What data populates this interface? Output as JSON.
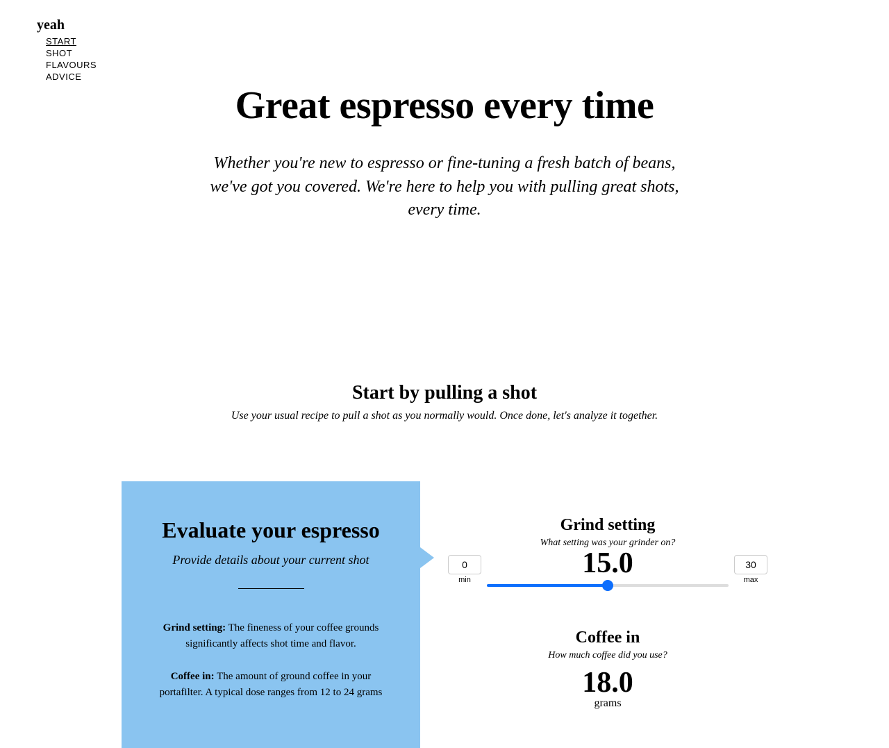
{
  "nav": {
    "logo": "yeah",
    "items": [
      {
        "label": "START",
        "active": true
      },
      {
        "label": "SHOT",
        "active": false
      },
      {
        "label": "FLAVOURS",
        "active": false
      },
      {
        "label": "ADVICE",
        "active": false
      }
    ]
  },
  "hero": {
    "title": "Great espresso every time",
    "subtitle": "Whether you're new to espresso or fine-tuning a fresh batch of beans, we've got you covered. We're here to help you with pulling great shots, every time."
  },
  "start": {
    "title": "Start by pulling a shot",
    "subtitle": "Use your usual recipe to pull a shot as you normally would. Once done, let's analyze it together."
  },
  "evaluate": {
    "title": "Evaluate your espresso",
    "subtitle": "Provide details about your current shot",
    "terms": [
      {
        "label": "Grind setting:",
        "desc": "The fineness of your coffee grounds significantly affects shot time and flavor."
      },
      {
        "label": "Coffee in:",
        "desc": "The amount of ground coffee in your portafilter. A typical dose ranges from 12 to 24 grams"
      }
    ]
  },
  "controls": {
    "grind": {
      "title": "Grind setting",
      "subtitle": "What setting was your grinder on?",
      "value": "15.0",
      "min": "0",
      "max": "30",
      "min_label": "min",
      "max_label": "max"
    },
    "coffee": {
      "title": "Coffee in",
      "subtitle": "How much coffee did you use?",
      "value": "18.0",
      "unit": "grams"
    }
  }
}
